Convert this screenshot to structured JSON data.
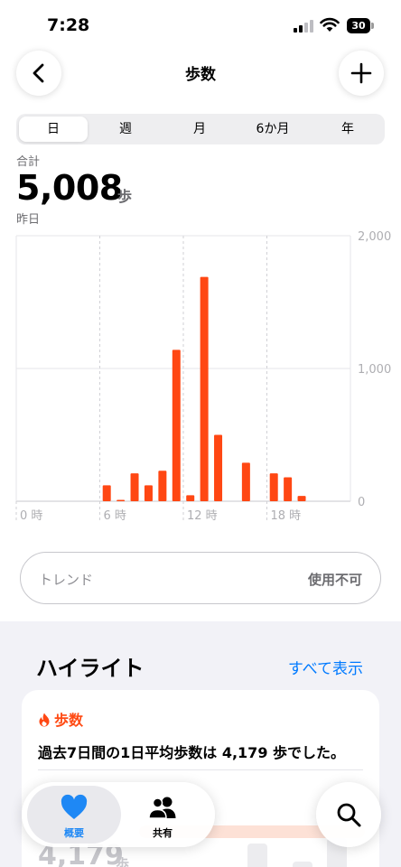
{
  "status_bar": {
    "time": "7:28",
    "battery": "30"
  },
  "nav": {
    "title": "歩数"
  },
  "tabs": [
    {
      "label": "日",
      "active": true
    },
    {
      "label": "週",
      "active": false
    },
    {
      "label": "月",
      "active": false
    },
    {
      "label": "6か月",
      "active": false
    },
    {
      "label": "年",
      "active": false
    }
  ],
  "summary": {
    "total_label": "合計",
    "value": "5,008",
    "unit": "歩",
    "date": "昨日"
  },
  "chart_data": {
    "type": "bar",
    "x_unit": "時",
    "x": [
      0,
      1,
      2,
      3,
      4,
      5,
      6,
      7,
      8,
      9,
      10,
      11,
      12,
      13,
      14,
      15,
      16,
      17,
      18,
      19,
      20,
      21,
      22,
      23
    ],
    "values": [
      0,
      0,
      0,
      0,
      0,
      0,
      120,
      10,
      210,
      120,
      230,
      1140,
      45,
      1690,
      500,
      0,
      290,
      0,
      210,
      180,
      40,
      0,
      0,
      0
    ],
    "x_tick_labels": [
      "0 時",
      "6 時",
      "12 時",
      "18 時"
    ],
    "y_tick_labels": [
      "0",
      "1,000",
      "2,000"
    ],
    "ylim": [
      0,
      2000
    ],
    "bar_color": "#ff4713"
  },
  "trend": {
    "label": "トレンド",
    "status": "使用不可"
  },
  "highlights": {
    "header": "ハイライト",
    "show_all": "すべて表示",
    "card": {
      "category": "歩数",
      "text": "過去7日間の1日平均歩数は 4,179 歩でした。",
      "avg_value": "4,179",
      "avg_unit": "歩"
    }
  },
  "tabbar": {
    "items": [
      {
        "label": "概要",
        "active": true
      },
      {
        "label": "共有",
        "active": false
      }
    ]
  },
  "colors": {
    "accent": "#ff4713",
    "link": "#007aff",
    "active_tab": "#1e88f5"
  }
}
